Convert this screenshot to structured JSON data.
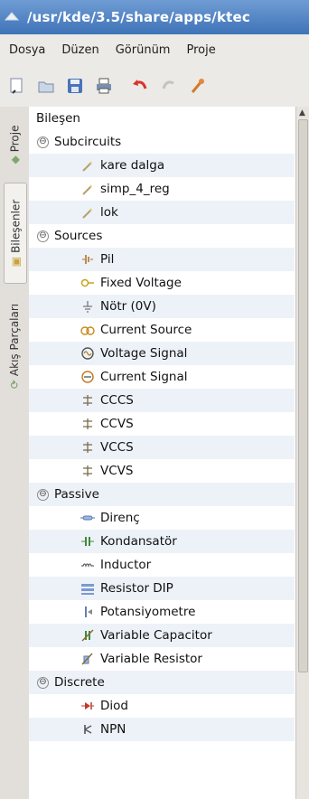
{
  "window": {
    "title": "/usr/kde/3.5/share/apps/ktec"
  },
  "menubar": [
    "Dosya",
    "Düzen",
    "Görünüm",
    "Proje"
  ],
  "toolbar": [
    "new-icon",
    "open-icon",
    "save-icon",
    "print-icon",
    "undo-icon",
    "redo-icon",
    "cut-icon"
  ],
  "sidetabs": [
    "Proje",
    "Bileşenler",
    "Akış Parçaları"
  ],
  "tree": {
    "header": "Bileşen",
    "categories": [
      {
        "label": "Subcircuits",
        "expander": "⊖",
        "items": [
          {
            "label": "kare dalga",
            "icon": "subcircuit-icon"
          },
          {
            "label": "simp_4_reg",
            "icon": "subcircuit-icon"
          },
          {
            "label": "lok",
            "icon": "subcircuit-icon"
          }
        ]
      },
      {
        "label": "Sources",
        "expander": "⊖",
        "items": [
          {
            "label": "Pil",
            "icon": "battery-icon"
          },
          {
            "label": "Fixed Voltage",
            "icon": "fixed-voltage-icon"
          },
          {
            "label": "Nötr (0V)",
            "icon": "ground-icon"
          },
          {
            "label": "Current Source",
            "icon": "current-source-icon"
          },
          {
            "label": "Voltage Signal",
            "icon": "voltage-signal-icon"
          },
          {
            "label": "Current Signal",
            "icon": "current-signal-icon"
          },
          {
            "label": "CCCS",
            "icon": "dependent-source-icon"
          },
          {
            "label": "CCVS",
            "icon": "dependent-source-icon"
          },
          {
            "label": "VCCS",
            "icon": "dependent-source-icon"
          },
          {
            "label": "VCVS",
            "icon": "dependent-source-icon"
          }
        ]
      },
      {
        "label": "Passive",
        "expander": "⊖",
        "items": [
          {
            "label": "Direnç",
            "icon": "resistor-icon"
          },
          {
            "label": "Kondansatör",
            "icon": "capacitor-icon"
          },
          {
            "label": "Inductor",
            "icon": "inductor-icon"
          },
          {
            "label": "Resistor DIP",
            "icon": "resistor-dip-icon"
          },
          {
            "label": "Potansiyometre",
            "icon": "potentiometer-icon"
          },
          {
            "label": "Variable Capacitor",
            "icon": "variable-capacitor-icon"
          },
          {
            "label": "Variable Resistor",
            "icon": "variable-resistor-icon"
          }
        ]
      },
      {
        "label": "Discrete",
        "expander": "⊖",
        "items": [
          {
            "label": "Diod",
            "icon": "diode-icon"
          },
          {
            "label": "NPN",
            "icon": "npn-icon"
          }
        ]
      }
    ]
  }
}
